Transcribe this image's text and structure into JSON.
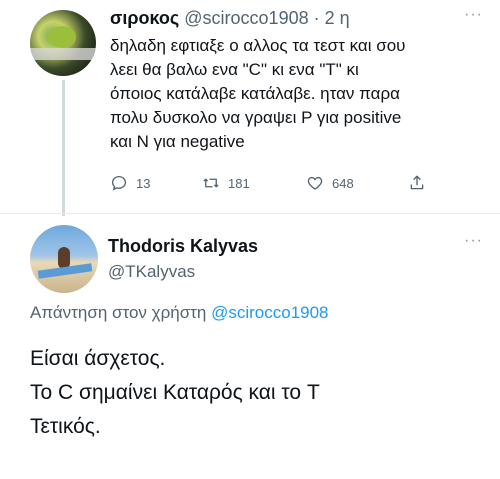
{
  "tweet1": {
    "name": "σιροκος",
    "handle": "@scirocco1908",
    "time": "· 2 η",
    "more_icon": "···",
    "lines": [
      "δηλαδη εφτιαξε ο αλλος τα τεστ και σου",
      "λεει θα βαλω ενα \"C\" κι ενα \"T\" κι",
      "όποιος κατάλαβε κατάλαβε. ηταν παρα",
      "πολυ δυσκολο να γραψει P για positive",
      "και N για negative"
    ],
    "actions": {
      "replies": "13",
      "retweets": "181",
      "likes": "648"
    }
  },
  "tweet2": {
    "name": "Thodoris Kalyvas",
    "handle": "@TKalyvas",
    "more_icon": "···",
    "reply_prefix": "Απάντηση στον χρήστη",
    "reply_mention": "@scirocco1908",
    "lines": [
      "Είσαι άσχετος.",
      "Το C σημαίνει Καταρός και το T",
      "Τετικός."
    ]
  }
}
